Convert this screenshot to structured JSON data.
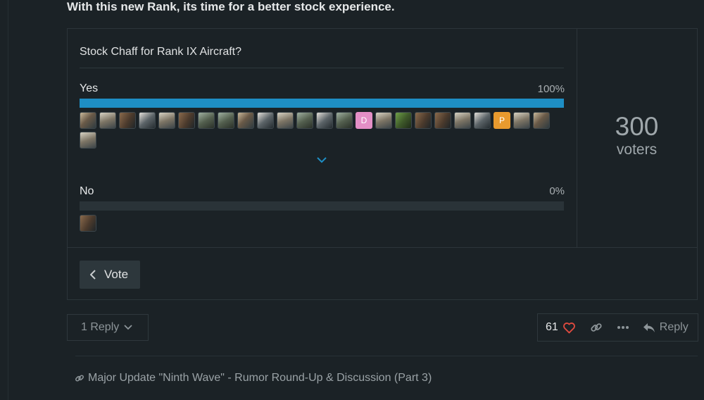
{
  "intro_text": "With this new Rank, its time for a better stock experience.",
  "poll": {
    "question": "Stock Chaff for Rank IX Aircraft?",
    "options": [
      {
        "label": "Yes",
        "percent_label": "100%",
        "percent": 100
      },
      {
        "label": "No",
        "percent_label": "0%",
        "percent": 0
      }
    ],
    "yes_avatar_letters": {
      "D": "D",
      "P": "P"
    },
    "voters_count": "300",
    "voters_label": "voters",
    "vote_button_label": "Vote"
  },
  "post_controls": {
    "replies_label": "1 Reply",
    "like_count": "61",
    "reply_label": "Reply"
  },
  "linked_topic": "Major Update \"Ninth Wave\" - Rumor Round-Up & Discussion (Part 3)",
  "colors": {
    "accent": "#1e8ec4",
    "heart": "#e04a3f",
    "avatar_d": "#e48fc6",
    "avatar_p": "#e89a2e"
  },
  "icons": [
    "chevron-left-icon",
    "chevron-down-icon",
    "heart-icon",
    "link-icon",
    "ellipsis-icon",
    "reply-arrow-icon"
  ]
}
